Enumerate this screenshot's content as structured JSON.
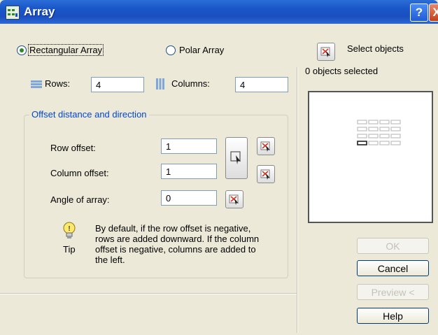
{
  "window": {
    "title": "Array",
    "help_glyph": "?",
    "close_glyph": "X"
  },
  "mode": {
    "rectangular_label": "Rectangular Array",
    "polar_label": "Polar Array",
    "selected": "rectangular"
  },
  "select": {
    "label": "Select objects",
    "status": "0 objects selected"
  },
  "rows": {
    "label": "Rows:",
    "value": "4"
  },
  "columns": {
    "label": "Columns:",
    "value": "4"
  },
  "offset_group": {
    "legend": "Offset distance and direction",
    "row_offset_label": "Row offset:",
    "row_offset_value": "1",
    "column_offset_label": "Column offset:",
    "column_offset_value": "1",
    "angle_label": "Angle of array:",
    "angle_value": "0"
  },
  "tip": {
    "label": "Tip",
    "text": "By default, if the row offset is negative, rows are added downward.  If the column offset is negative, columns are added to the left."
  },
  "buttons": {
    "ok": "OK",
    "cancel": "Cancel",
    "preview": "Preview <",
    "help": "Help"
  },
  "colors": {
    "title_bar": "#1a56c8",
    "group_legend": "#0046d5",
    "radio_dot": "#2a8a2a"
  }
}
